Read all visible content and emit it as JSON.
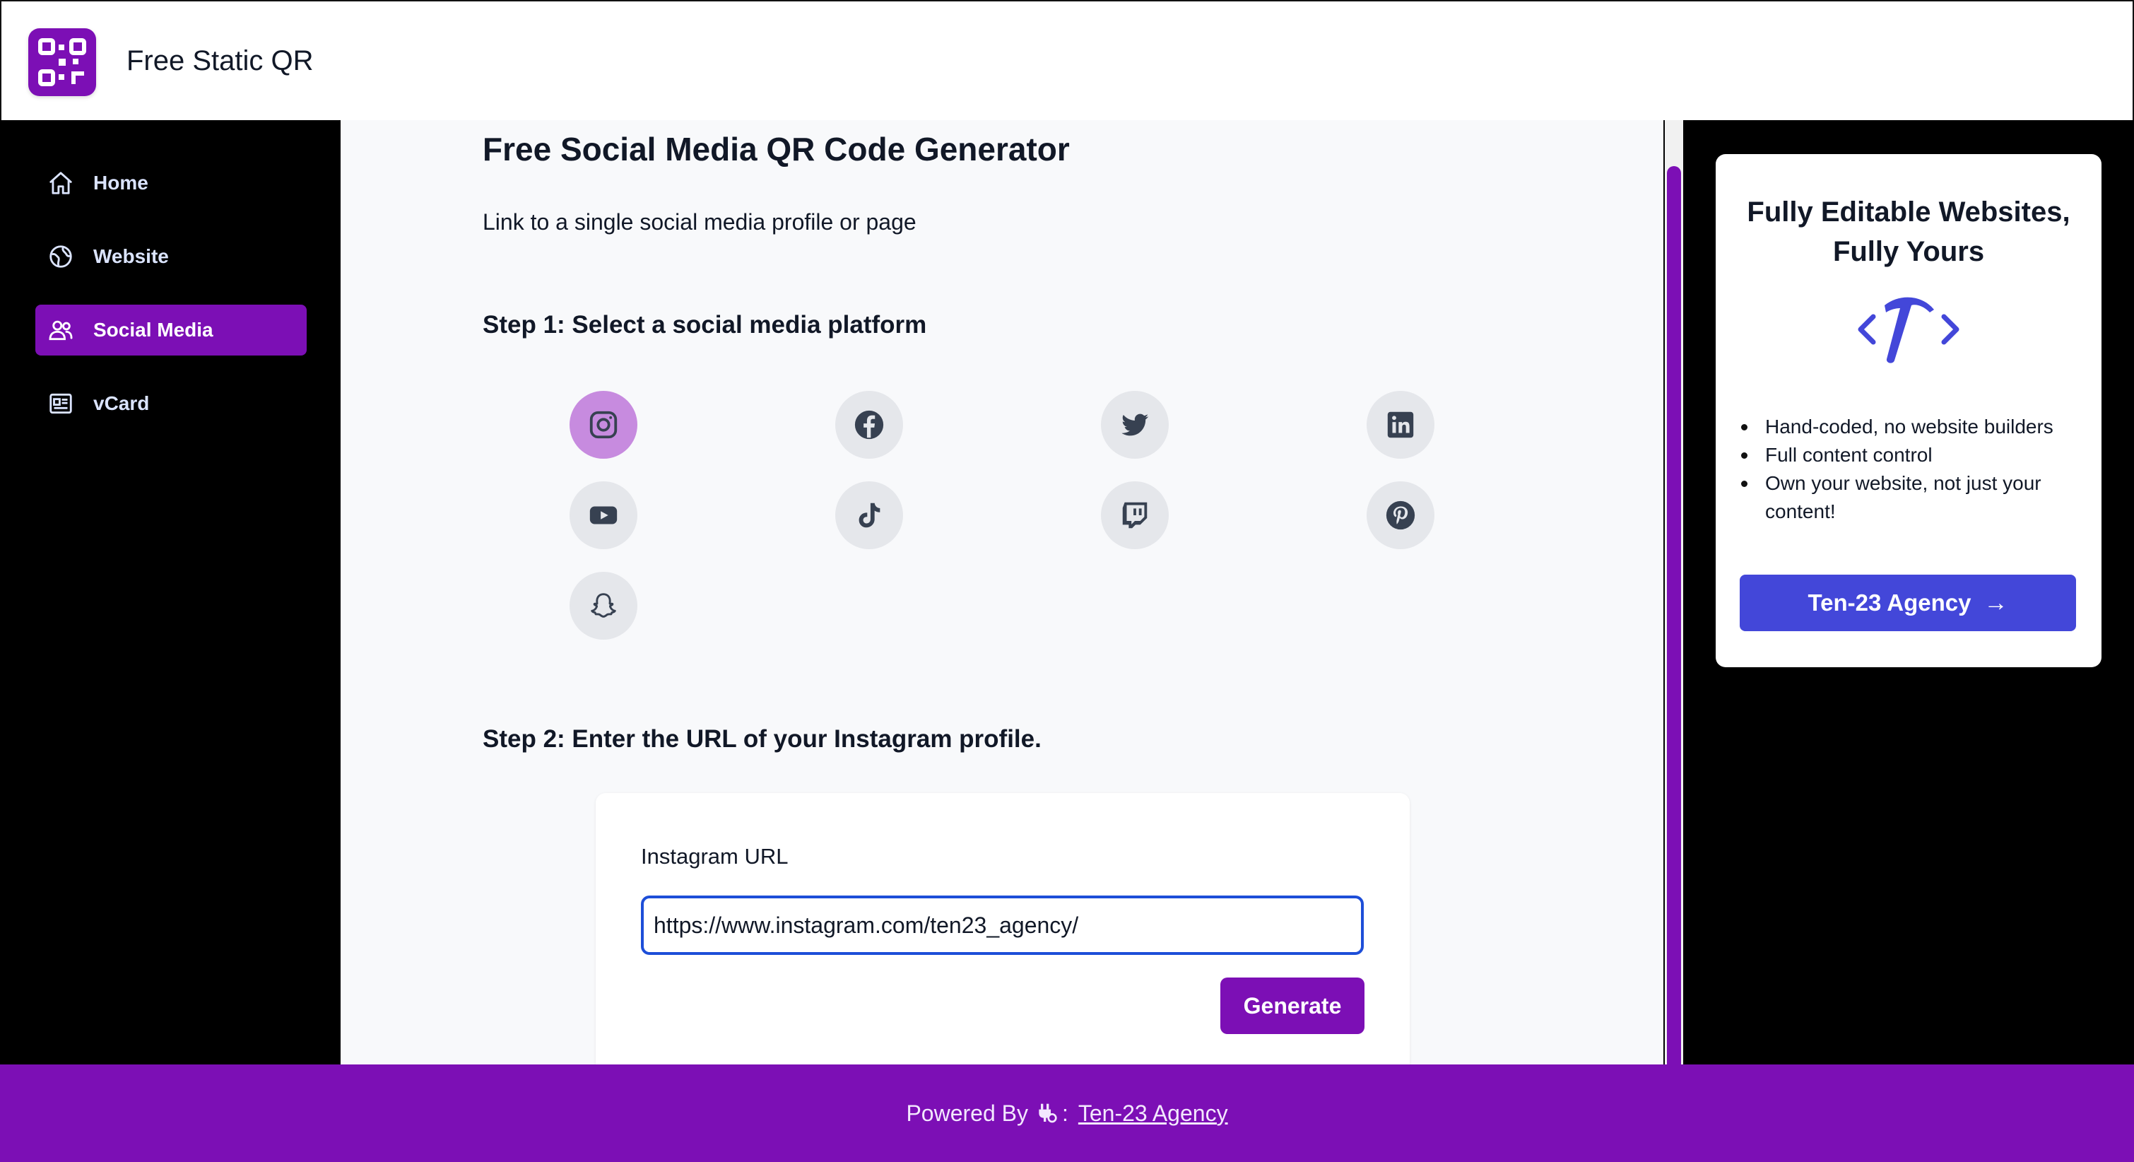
{
  "app": {
    "title": "Free Static QR"
  },
  "sidebar": {
    "items": [
      {
        "label": "Home",
        "icon": "home-icon",
        "active": false
      },
      {
        "label": "Website",
        "icon": "globe-icon",
        "active": false
      },
      {
        "label": "Social Media",
        "icon": "users-icon",
        "active": true
      },
      {
        "label": "vCard",
        "icon": "id-card-icon",
        "active": false
      }
    ]
  },
  "main": {
    "title": "Free Social Media QR Code Generator",
    "subtitle": "Link to a single social media profile or page",
    "step1": "Step 1: Select a social media platform",
    "platforms": [
      {
        "name": "instagram",
        "icon": "instagram-icon",
        "selected": true
      },
      {
        "name": "facebook",
        "icon": "facebook-icon",
        "selected": false
      },
      {
        "name": "twitter",
        "icon": "twitter-icon",
        "selected": false
      },
      {
        "name": "linkedin",
        "icon": "linkedin-icon",
        "selected": false
      },
      {
        "name": "youtube",
        "icon": "youtube-icon",
        "selected": false
      },
      {
        "name": "tiktok",
        "icon": "tiktok-icon",
        "selected": false
      },
      {
        "name": "twitch",
        "icon": "twitch-icon",
        "selected": false
      },
      {
        "name": "pinterest",
        "icon": "pinterest-icon",
        "selected": false
      },
      {
        "name": "snapchat",
        "icon": "snapchat-icon",
        "selected": false
      }
    ],
    "step2": "Step 2: Enter the URL of your Instagram profile.",
    "form": {
      "label": "Instagram URL",
      "value": "https://www.instagram.com/ten23_agency/",
      "button": "Generate"
    }
  },
  "ad": {
    "title_line1": "Fully Editable Websites,",
    "title_line2": "Fully Yours",
    "icon": "code-hammer-icon",
    "bullets": [
      "Hand-coded, no website builders",
      "Full content control",
      "Own your website, not just your content!"
    ],
    "button": "Ten-23 Agency",
    "button_arrow": "→"
  },
  "footer": {
    "prefix": "Powered By",
    "separator": ":",
    "link": "Ten-23 Agency"
  },
  "colors": {
    "brand_purple": "#7c0fb5",
    "selected_platform": "#c78bdf",
    "ad_button": "#4347d9",
    "input_focus": "#1d4ed8"
  }
}
